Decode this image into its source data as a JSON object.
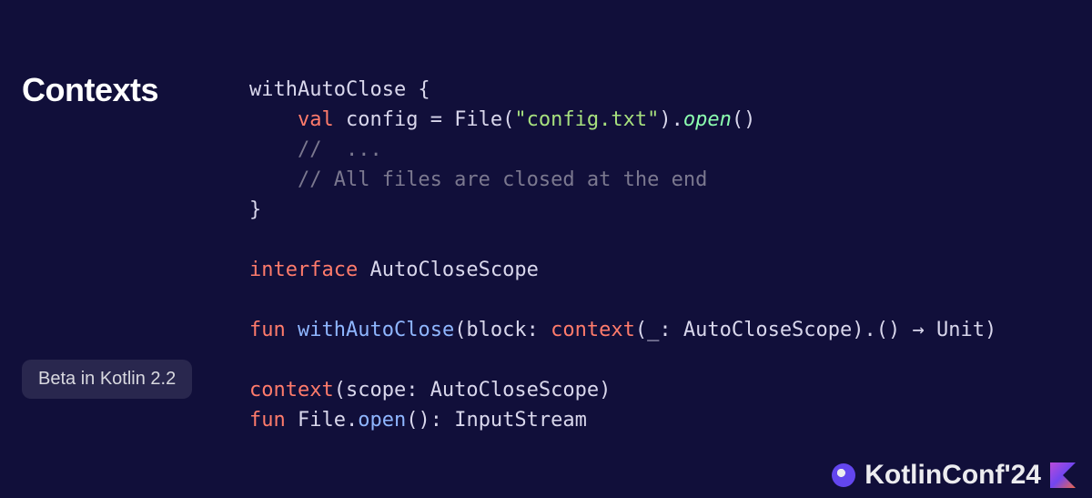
{
  "title": "Contexts",
  "badge": "Beta in Kotlin 2.2",
  "footer": {
    "brand": "KotlinConf'24"
  },
  "code": {
    "l1": {
      "fn": "withAutoClose",
      "brace": " {"
    },
    "l2": {
      "kw": "val",
      "name": " config = ",
      "cls": "File",
      "paren_open": "(",
      "str": "\"config.txt\"",
      "paren_close": ").",
      "call": "open",
      "tail": "()"
    },
    "l3": {
      "cmt": "//  ..."
    },
    "l4": {
      "cmt": "// All files are closed at the end"
    },
    "l5": {
      "brace": "}"
    },
    "l6": {
      "kw": "interface",
      "name": " AutoCloseScope"
    },
    "l7": {
      "kw": "fun",
      "sp": " ",
      "fn": "withAutoClose",
      "sig1": "(block: ",
      "ctx": "context",
      "sig2": "(_: AutoCloseScope).() → Unit)"
    },
    "l8": {
      "ctx": "context",
      "sig": "(scope: AutoCloseScope)"
    },
    "l9": {
      "kw": "fun",
      "sp": " ",
      "recv": "File.",
      "fn": "open",
      "sig": "(): InputStream"
    }
  }
}
